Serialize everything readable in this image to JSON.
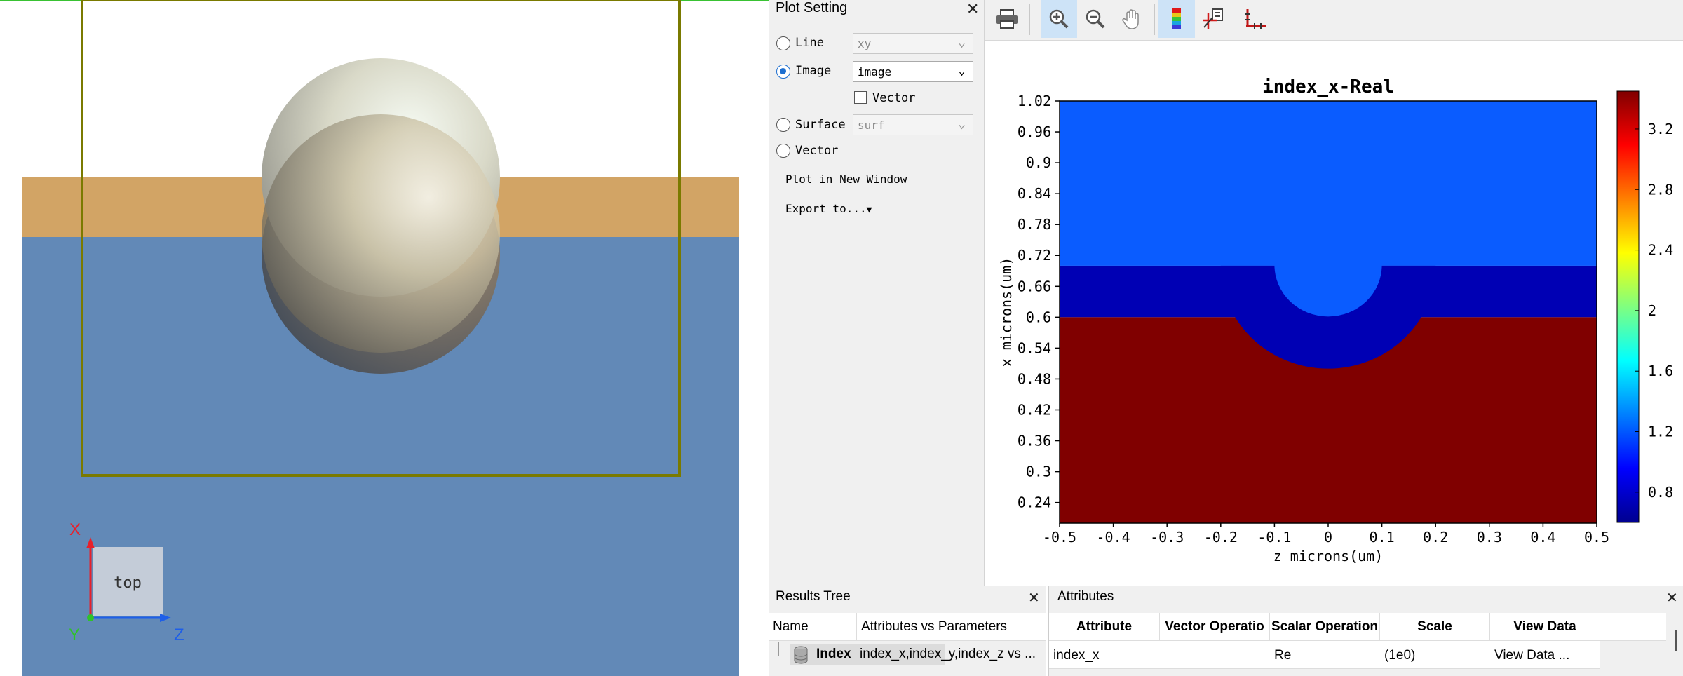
{
  "viewport": {
    "view_label": "top",
    "axes": {
      "x": "X",
      "y": "Y",
      "z": "Z"
    }
  },
  "plot_setting": {
    "title": "Plot Setting",
    "options": [
      {
        "label": "Line",
        "selected": false,
        "select_value": "xy",
        "enabled": false
      },
      {
        "label": "Image",
        "selected": true,
        "select_value": "image",
        "enabled": true
      },
      {
        "label": "Surface",
        "selected": false,
        "select_value": "surf",
        "enabled": false
      },
      {
        "label": "Vector",
        "selected": false
      }
    ],
    "vector_checkbox_label": "Vector",
    "plot_new_window": "Plot in New Window",
    "export_to": "Export to..."
  },
  "toolbar": {
    "icons": [
      "print-icon",
      "zoom-in-icon",
      "zoom-out-icon",
      "pan-hand-icon",
      "colorbar-icon",
      "data-cursor-icon",
      "axes-icon"
    ]
  },
  "chart_data": {
    "type": "heatmap",
    "title": "index_x-Real",
    "xlabel": "z microns(um)",
    "ylabel": "x microns(um)",
    "x_ticks": [
      "-0.5",
      "-0.4",
      "-0.3",
      "-0.2",
      "-0.1",
      "0",
      "0.1",
      "0.2",
      "0.3",
      "0.4",
      "0.5"
    ],
    "y_ticks": [
      "1.02",
      "0.96",
      "0.9",
      "0.84",
      "0.78",
      "0.72",
      "0.66",
      "0.6",
      "0.54",
      "0.48",
      "0.42",
      "0.36",
      "0.3",
      "0.24"
    ],
    "xlim": [
      -0.5,
      0.5
    ],
    "ylim": [
      0.2,
      1.02
    ],
    "colorbar_ticks": [
      "3.2",
      "2.8",
      "2.4",
      "2",
      "1.6",
      "1.2",
      "0.8"
    ],
    "colorbar_range": [
      0.6,
      3.45
    ],
    "regions": [
      {
        "name": "upper",
        "value": 1.0,
        "color": "#0a5cff"
      },
      {
        "name": "layer",
        "value": 0.6,
        "color": "#0000b4"
      },
      {
        "name": "substrate",
        "value": 3.45,
        "color": "#800000"
      }
    ],
    "layer_top": 0.7,
    "layer_bottom": 0.6,
    "sphere_center": [
      0.0,
      0.7
    ],
    "sphere_radius": 0.2,
    "shell_thickness": 0.1
  },
  "results_tree": {
    "title": "Results Tree",
    "columns": [
      "Name",
      "Attributes vs Parameters"
    ],
    "rows": [
      {
        "name": "Index",
        "attributes": "index_x,index_y,index_z vs ..."
      }
    ]
  },
  "attributes": {
    "title": "Attributes",
    "columns": [
      "Attribute",
      "Vector Operatio",
      "Scalar Operation",
      "Scale",
      "View Data"
    ],
    "rows": [
      {
        "attribute": "index_x",
        "vector_op": "",
        "scalar_op": "Re",
        "scale": "(1e0)",
        "view_data": "View Data ..."
      }
    ]
  }
}
